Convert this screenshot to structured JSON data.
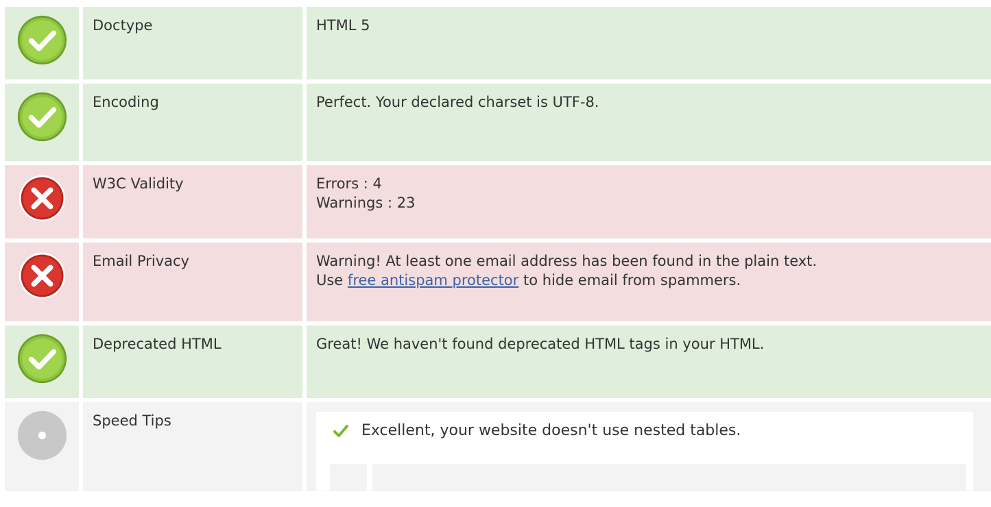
{
  "rows": [
    {
      "status": "ok",
      "icon": "check-circle-icon",
      "label": "Doctype",
      "value_lines": [
        "HTML 5"
      ]
    },
    {
      "status": "ok",
      "icon": "check-circle-icon",
      "label": "Encoding",
      "value_lines": [
        "Perfect. Your declared charset is UTF-8."
      ]
    },
    {
      "status": "error",
      "icon": "error-circle-icon",
      "label": "W3C Validity",
      "value_lines": [
        "Errors : 4",
        "Warnings : 23"
      ]
    },
    {
      "status": "error",
      "icon": "error-circle-icon",
      "label": "Email Privacy",
      "value_line_1": "Warning! At least one email address has been found in the plain text.",
      "value_line_2_prefix": "Use ",
      "value_line_2_link": "free antispam protector",
      "value_line_2_suffix": " to hide email from spammers."
    },
    {
      "status": "ok",
      "icon": "check-circle-icon",
      "label": "Deprecated HTML",
      "value_lines": [
        "Great! We haven't found deprecated HTML tags in your HTML."
      ]
    },
    {
      "status": "neutral",
      "icon": "info-circle-icon",
      "label": "Speed Tips",
      "tips": [
        {
          "icon": "check-mark-icon",
          "text": "Excellent, your website doesn't use nested tables."
        }
      ]
    }
  ],
  "colors": {
    "ok_bg": "#dfefdb",
    "error_bg": "#f3dddf",
    "neutral_bg": "#f3f3f3",
    "ok_icon": "#8cc63f",
    "error_icon": "#d9362f",
    "neutral_icon": "#c8c8c8",
    "link": "#3e63a5"
  }
}
